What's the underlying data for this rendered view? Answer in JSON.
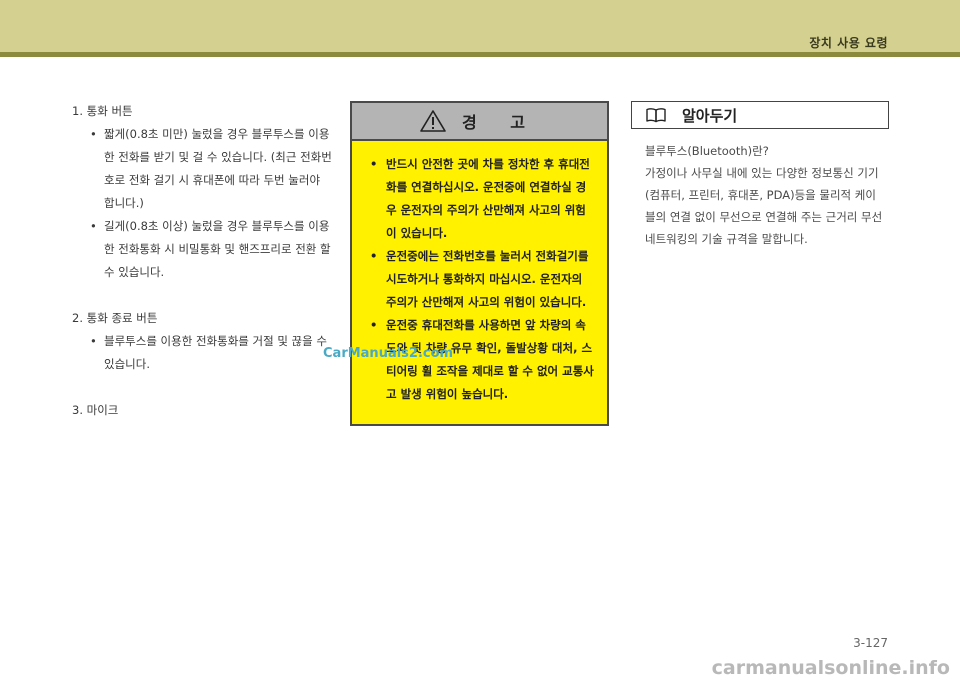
{
  "header": {
    "section_title": "장치 사용 요령",
    "colors": {
      "band": "#d4d08f",
      "rule": "#8b8a3d"
    }
  },
  "left_column": {
    "items": [
      {
        "heading": "1. 통화 버튼",
        "bullets": [
          "짧게(0.8초 미만) 눌렀을 경우 블루투스를 이용한 전화를 받기 및 걸 수 있습니다. (최근 전화번호로 전화 걸기 시 휴대폰에 따라 두번 눌러야 합니다.)",
          "길게(0.8초 이상) 눌렀을 경우 블루투스를 이용한 전화통화 시 비밀통화 및 핸즈프리로 전환 할 수 있습니다."
        ]
      },
      {
        "heading": "2. 통화 종료 버튼",
        "bullets": [
          "블루투스를 이용한 전화통화를 거절 및 끊을 수 있습니다."
        ]
      },
      {
        "heading": "3. 마이크",
        "bullets": []
      }
    ]
  },
  "warning": {
    "title": "경 고",
    "icon": "warning-triangle-icon",
    "colors": {
      "body": "#fff100",
      "head": "#b4b4b4"
    },
    "bullets": [
      "반드시 안전한 곳에 차를 정차한 후 휴대전화를 연결하십시오. 운전중에 연결하실 경우 운전자의 주의가 산만해져 사고의 위험이 있습니다.",
      "운전중에는 전화번호를 눌러서 전화걸기를 시도하거나 통화하지 마십시오. 운전자의 주의가 산만해져 사고의 위험이 있습니다.",
      "운전중 휴대전화를 사용하면 앞 차량의 속도와 뒷 차량 유무 확인, 돌발상황 대처, 스티어링 휠 조작을 제대로 할 수 없어 교통사고 발생 위험이 높습니다."
    ]
  },
  "note": {
    "title": "알아두기",
    "icon": "book-icon",
    "lines": [
      "블루투스(Bluetooth)란?",
      "가정이나 사무실 내에 있는 다양한 정보통신 기기(컴퓨터, 프린터, 휴대폰, PDA)등을 물리적 케이블의 연결 없이 무선으로 연결해 주는 근거리 무선 네트워킹의 기술 규격을 말합니다."
    ]
  },
  "footer": {
    "page_number": "3-127",
    "watermark_mid": "CarManuals2.com",
    "watermark_bottom": "carmanualsonline.info"
  }
}
